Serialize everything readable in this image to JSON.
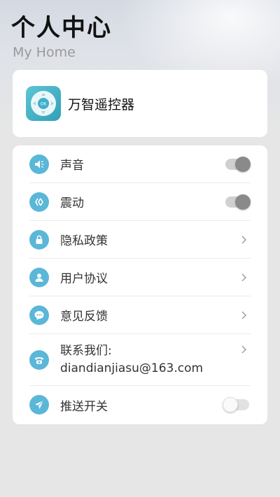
{
  "header": {
    "title": "个人中心",
    "subtitle": "My Home"
  },
  "app": {
    "name": "万智遥控器",
    "icon_center_label": "OK"
  },
  "settings": {
    "items": [
      {
        "label": "声音",
        "icon": "speaker-icon",
        "control": "toggle",
        "state": "on"
      },
      {
        "label": "震动",
        "icon": "vibrate-icon",
        "control": "toggle",
        "state": "on"
      },
      {
        "label": "隐私政策",
        "icon": "lock-icon",
        "control": "chevron"
      },
      {
        "label": "用户协议",
        "icon": "user-icon",
        "control": "chevron"
      },
      {
        "label": "意见反馈",
        "icon": "chat-icon",
        "control": "chevron"
      },
      {
        "label": "联系我们:",
        "label_line2": "diandianjiasu@163.com",
        "icon": "phone-icon",
        "control": "chevron"
      },
      {
        "label": "推送开关",
        "icon": "send-icon",
        "control": "toggle",
        "state": "off"
      }
    ]
  },
  "colors": {
    "accent": "#5ab7d8",
    "card": "#ffffff",
    "background": "#e6e6e6"
  }
}
